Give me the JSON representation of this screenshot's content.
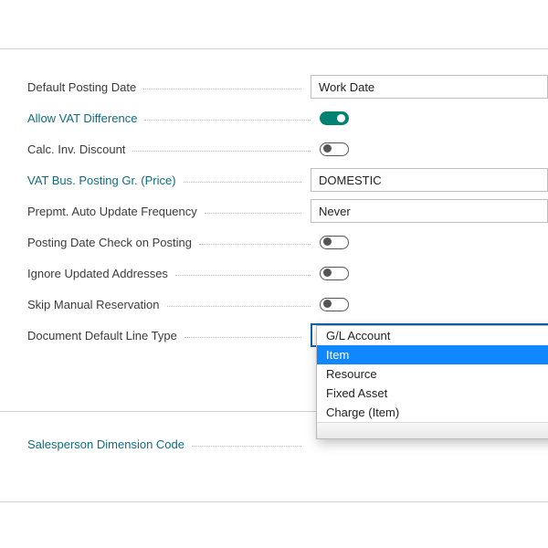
{
  "fields": {
    "default_posting_date": {
      "label": "Default Posting Date",
      "value": "Work Date"
    },
    "allow_vat_difference": {
      "label": "Allow VAT Difference",
      "on": true
    },
    "calc_inv_discount": {
      "label": "Calc. Inv. Discount",
      "on": false
    },
    "vat_bus_posting_gr_price": {
      "label": "VAT Bus. Posting Gr. (Price)",
      "value": "DOMESTIC"
    },
    "prepmt_auto_update_frequency": {
      "label": "Prepmt. Auto Update Frequency",
      "value": "Never"
    },
    "posting_date_check_on_posting": {
      "label": "Posting Date Check on Posting",
      "on": false
    },
    "ignore_updated_addresses": {
      "label": "Ignore Updated Addresses",
      "on": false
    },
    "skip_manual_reservation": {
      "label": "Skip Manual Reservation",
      "on": false
    },
    "document_default_line_type": {
      "label": "Document Default Line Type",
      "value": "Item"
    },
    "salesperson_dimension_code": {
      "label": "Salesperson Dimension Code",
      "value": ""
    }
  },
  "dropdown": {
    "options": [
      "G/L Account",
      "Item",
      "Resource",
      "Fixed Asset",
      "Charge (Item)"
    ],
    "selected": "Item"
  }
}
